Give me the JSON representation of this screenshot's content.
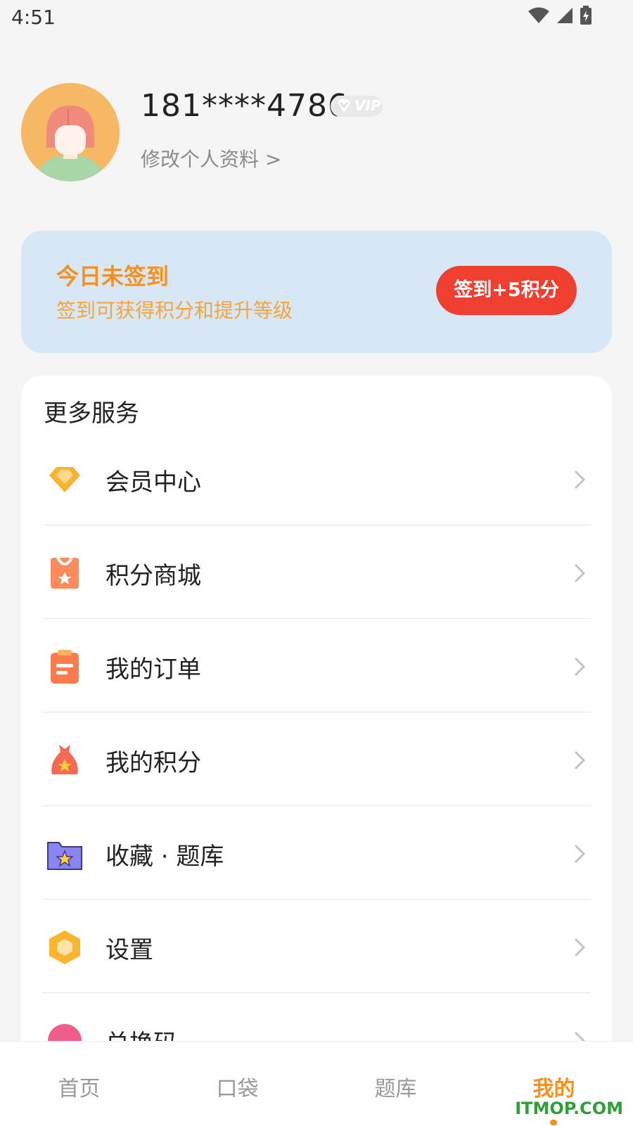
{
  "status_bar": {
    "time": "4:51"
  },
  "profile": {
    "phone": "181****4786",
    "vip_label": "VIP",
    "edit_label": "修改个人资料 >"
  },
  "checkin": {
    "title": "今日未签到",
    "subtitle": "签到可获得积分和提升等级",
    "button": "签到+5积分"
  },
  "services": {
    "title": "更多服务",
    "items": [
      {
        "label": "会员中心",
        "icon": "diamond-icon"
      },
      {
        "label": "积分商城",
        "icon": "shop-bag-icon"
      },
      {
        "label": "我的订单",
        "icon": "order-clipboard-icon"
      },
      {
        "label": "我的积分",
        "icon": "money-bag-icon"
      },
      {
        "label": "收藏 · 题库",
        "icon": "star-folder-icon"
      },
      {
        "label": "设置",
        "icon": "hexagon-settings-icon"
      },
      {
        "label": "兑换码",
        "icon": "pink-circle-icon"
      }
    ]
  },
  "bottom_nav": {
    "items": [
      "首页",
      "口袋",
      "题库",
      "我的"
    ],
    "active": "我的"
  },
  "watermark": "ITMOP.COM",
  "colors": {
    "accent_orange": "#f7901e",
    "checkin_button": "#ee3f31",
    "checkin_bg": "#d7e7f6"
  }
}
